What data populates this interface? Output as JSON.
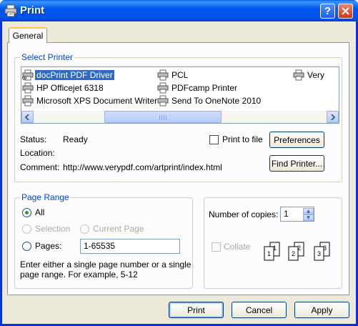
{
  "window": {
    "title": "Print"
  },
  "tabs": [
    {
      "label": "General"
    }
  ],
  "select_printer": {
    "legend": "Select Printer",
    "printers": [
      {
        "name": "docPrint PDF Driver",
        "selected": true
      },
      {
        "name": "HP Officejet 6318",
        "selected": false
      },
      {
        "name": "Microsoft XPS Document Writer",
        "selected": false
      },
      {
        "name": "PCL",
        "selected": false
      },
      {
        "name": "PDFcamp Printer",
        "selected": false
      },
      {
        "name": "Send To OneNote 2010",
        "selected": false
      },
      {
        "name": "Very",
        "selected": false
      }
    ],
    "status_label": "Status:",
    "status_value": "Ready",
    "location_label": "Location:",
    "location_value": "",
    "comment_label": "Comment:",
    "comment_value": "http://www.verypdf.com/artprint/index.html",
    "print_to_file_label": "Print to file",
    "preferences_label": "Preferences",
    "find_printer_label": "Find Printer..."
  },
  "page_range": {
    "legend": "Page Range",
    "all_label": "All",
    "selection_label": "Selection",
    "current_page_label": "Current Page",
    "pages_label": "Pages:",
    "pages_value": "1-65535",
    "hint_line1": "Enter either a single page number or a single",
    "hint_line2": "page range.  For example, 5-12",
    "selected": "all"
  },
  "copies": {
    "number_label": "Number of copies:",
    "number_value": "1",
    "collate_label": "Collate",
    "collate_enabled": false
  },
  "buttons": {
    "print": "Print",
    "cancel": "Cancel",
    "apply": "Apply"
  },
  "colors": {
    "title_bar": "#0058ee",
    "group_legend": "#0046d5",
    "selection": "#316ac5"
  }
}
